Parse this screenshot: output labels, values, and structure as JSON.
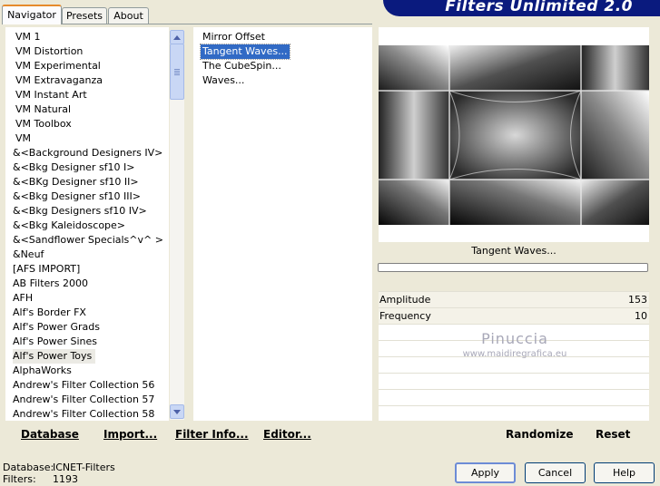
{
  "tabs": [
    "Navigator",
    "Presets",
    "About"
  ],
  "banner_title": "Filters Unlimited 2.0",
  "categories": [
    "VM 1",
    "VM Distortion",
    "VM Experimental",
    "VM Extravaganza",
    "VM Instant Art",
    "VM Natural",
    "VM Toolbox",
    "VM",
    "&<Background Designers IV>",
    "&<Bkg Designer sf10 I>",
    "&<BKg Designer sf10 II>",
    "&<Bkg Designer sf10 III>",
    "&<Bkg Designers sf10 IV>",
    "&<Bkg Kaleidoscope>",
    "&<Sandflower Specials^v^ >",
    "&Neuf",
    "[AFS IMPORT]",
    "AB Filters 2000",
    "AFH",
    "Alf's Border FX",
    "Alf's Power Grads",
    "Alf's Power Sines",
    "Alf's Power Toys",
    "AlphaWorks",
    "Andrew's Filter Collection 56",
    "Andrew's Filter Collection 57",
    "Andrew's Filter Collection 58"
  ],
  "selected_category": "Alf's Power Toys",
  "filters": [
    "Mirror Offset",
    "Tangent Waves...",
    "The CubeSpin...",
    "Waves..."
  ],
  "selected_filter": "Tangent Waves...",
  "preview_filter_name": "Tangent Waves...",
  "params": [
    {
      "label": "Amplitude",
      "value": "153"
    },
    {
      "label": "Frequency",
      "value": "10"
    }
  ],
  "watermark": {
    "name": "Pinuccia",
    "site": "www.maidiregrafica.eu"
  },
  "toolbar": {
    "database": "Database",
    "import": "Import...",
    "filter_info": "Filter Info...",
    "editor": "Editor...",
    "randomize": "Randomize",
    "reset": "Reset"
  },
  "status": {
    "database_label": "Database:",
    "database_value": "ICNET-Filters",
    "filters_label": "Filters:",
    "filters_value": "1193"
  },
  "buttons": {
    "apply": "Apply",
    "cancel": "Cancel",
    "help": "Help"
  }
}
